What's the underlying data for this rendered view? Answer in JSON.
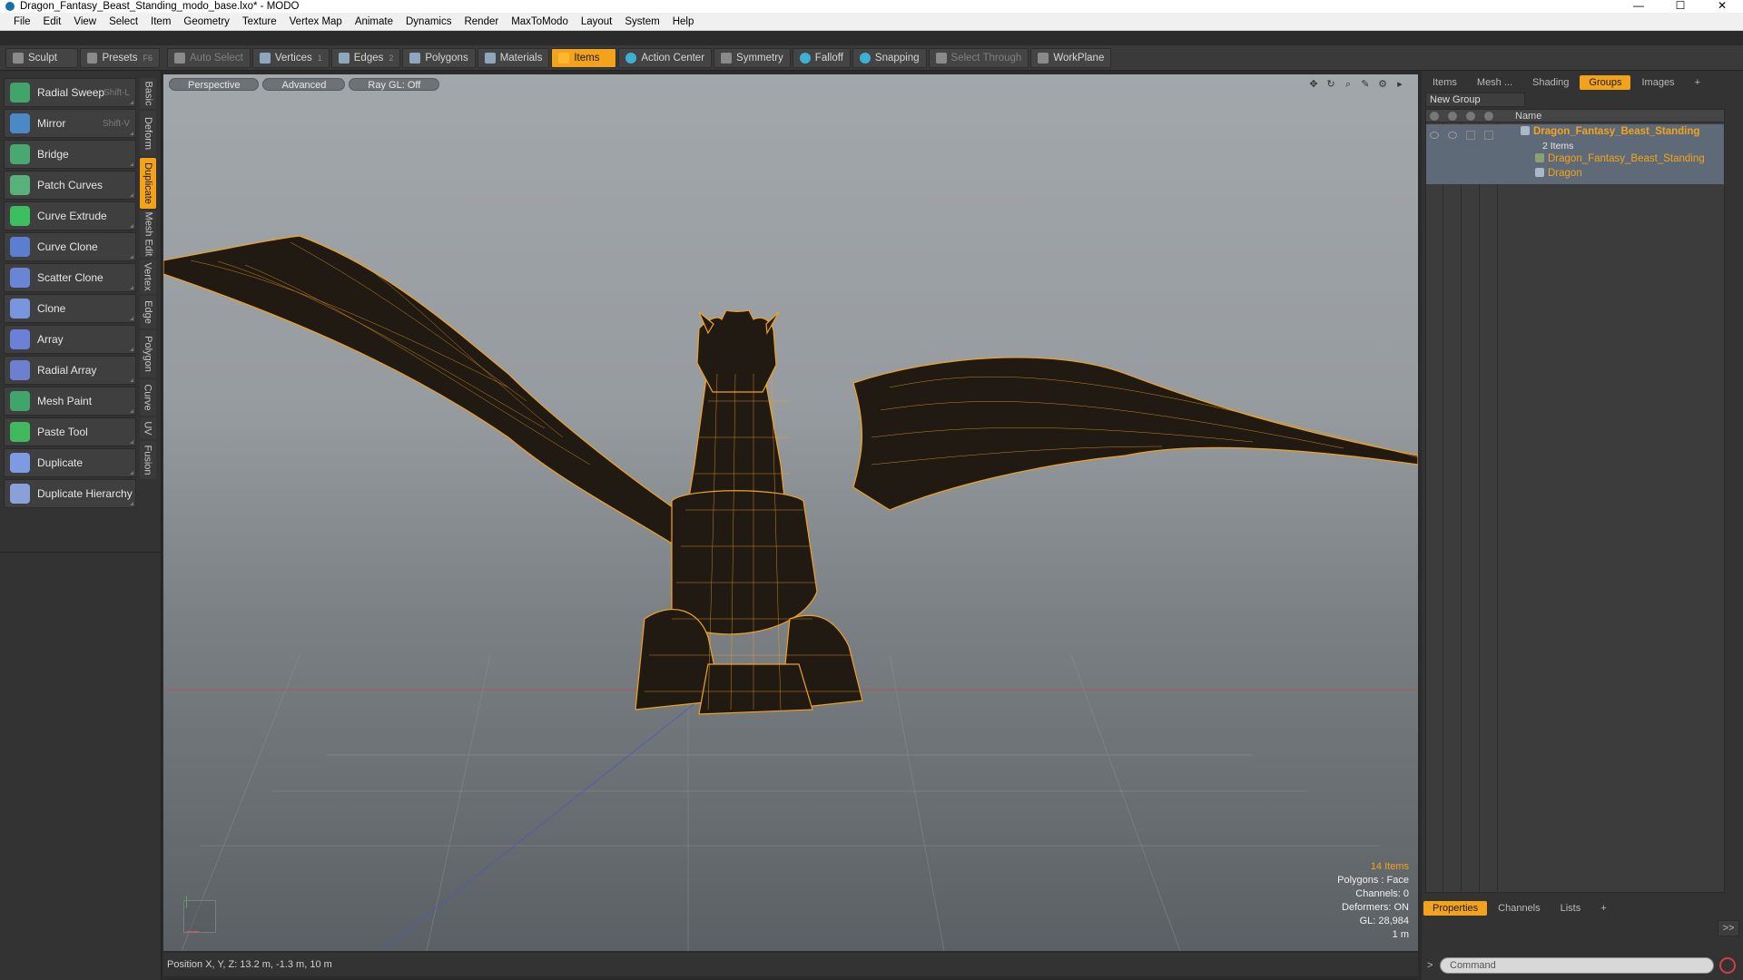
{
  "window": {
    "title": "Dragon_Fantasy_Beast_Standing_modo_base.lxo* - MODO",
    "min": "—",
    "max": "☐",
    "close": "✕"
  },
  "menu": [
    "File",
    "Edit",
    "View",
    "Select",
    "Item",
    "Geometry",
    "Texture",
    "Vertex Map",
    "Animate",
    "Dynamics",
    "Render",
    "MaxToModo",
    "Layout",
    "System",
    "Help"
  ],
  "toolbar": {
    "sculpt": "Sculpt",
    "presets": "Presets",
    "presets_key": "F6",
    "auto_select": "Auto Select",
    "vertices": "Vertices",
    "vertices_count": "1",
    "edges": "Edges",
    "edges_count": "2",
    "polygons": "Polygons",
    "materials": "Materials",
    "items": "Items",
    "action_center": "Action Center",
    "symmetry": "Symmetry",
    "falloff": "Falloff",
    "snapping": "Snapping",
    "select_through": "Select Through",
    "workplane": "WorkPlane"
  },
  "tools": [
    {
      "label": "Radial Sweep",
      "shortcut": "Shift-L",
      "color": "#3fa56b"
    },
    {
      "label": "Mirror",
      "shortcut": "Shift-V",
      "color": "#4a88c7"
    },
    {
      "label": "Bridge",
      "shortcut": "",
      "color": "#47a870"
    },
    {
      "label": "Patch Curves",
      "shortcut": "",
      "color": "#58b07a"
    },
    {
      "label": "Curve Extrude",
      "shortcut": "",
      "color": "#3bbf5f"
    },
    {
      "label": "Curve Clone",
      "shortcut": "",
      "color": "#5a7fd0"
    },
    {
      "label": "Scatter Clone",
      "shortcut": "",
      "color": "#6a84d6"
    },
    {
      "label": "Clone",
      "shortcut": "",
      "color": "#7a95e0"
    },
    {
      "label": "Array",
      "shortcut": "",
      "color": "#6b80d8"
    },
    {
      "label": "Radial Array",
      "shortcut": "",
      "color": "#6c7fd0"
    },
    {
      "label": "Mesh Paint",
      "shortcut": "",
      "color": "#3fa56b"
    },
    {
      "label": "Paste Tool",
      "shortcut": "",
      "color": "#42b85c"
    },
    {
      "label": "Duplicate",
      "shortcut": "",
      "color": "#7e9ae4"
    },
    {
      "label": "Duplicate Hierarchy",
      "shortcut": "",
      "color": "#8aa0d8"
    }
  ],
  "vtabs": [
    {
      "label": "Basic",
      "active": false
    },
    {
      "label": "Deform",
      "active": false
    },
    {
      "label": "Duplicate",
      "active": true
    },
    {
      "label": "Mesh Edit",
      "active": false
    },
    {
      "label": "Vertex",
      "active": false
    },
    {
      "label": "Edge",
      "active": false
    },
    {
      "label": "Polygon",
      "active": false
    },
    {
      "label": "Curve",
      "active": false
    },
    {
      "label": "UV",
      "active": false
    },
    {
      "label": "Fusion",
      "active": false
    }
  ],
  "viewport": {
    "tabs": [
      "Perspective",
      "Advanced",
      "Ray GL: Off"
    ],
    "icons": [
      "✥",
      "↻",
      "⌕",
      "✎",
      "⚙",
      "▸"
    ],
    "stats": {
      "items": "14 Items",
      "polygons": "Polygons : Face",
      "channels": "Channels: 0",
      "deformers": "Deformers: ON",
      "gl": "GL: 28,984",
      "scale": "1 m"
    },
    "wire_color": "#f3a31b"
  },
  "status": {
    "position": "Position X, Y, Z:  13.2 m, -1.3 m, 10 m"
  },
  "right_panel": {
    "tabs": [
      {
        "label": "Items",
        "active": false
      },
      {
        "label": "Mesh ...",
        "active": false
      },
      {
        "label": "Shading",
        "active": false
      },
      {
        "label": "Groups",
        "active": true
      },
      {
        "label": "Images",
        "active": false
      },
      {
        "label": "+",
        "active": false
      }
    ],
    "new_group": "New Group",
    "name_header": "Name",
    "group": {
      "name": "Dragon_Fantasy_Beast_Standing",
      "count": "2 Items",
      "children": [
        "Dragon_Fantasy_Beast_Standing",
        "Dragon"
      ]
    },
    "bottom_tabs": [
      {
        "label": "Properties",
        "active": true
      },
      {
        "label": "Channels",
        "active": false
      },
      {
        "label": "Lists",
        "active": false
      },
      {
        "label": "+",
        "active": false
      }
    ],
    "expand": ">>",
    "command_placeholder": "Command",
    "prompt": ">"
  }
}
